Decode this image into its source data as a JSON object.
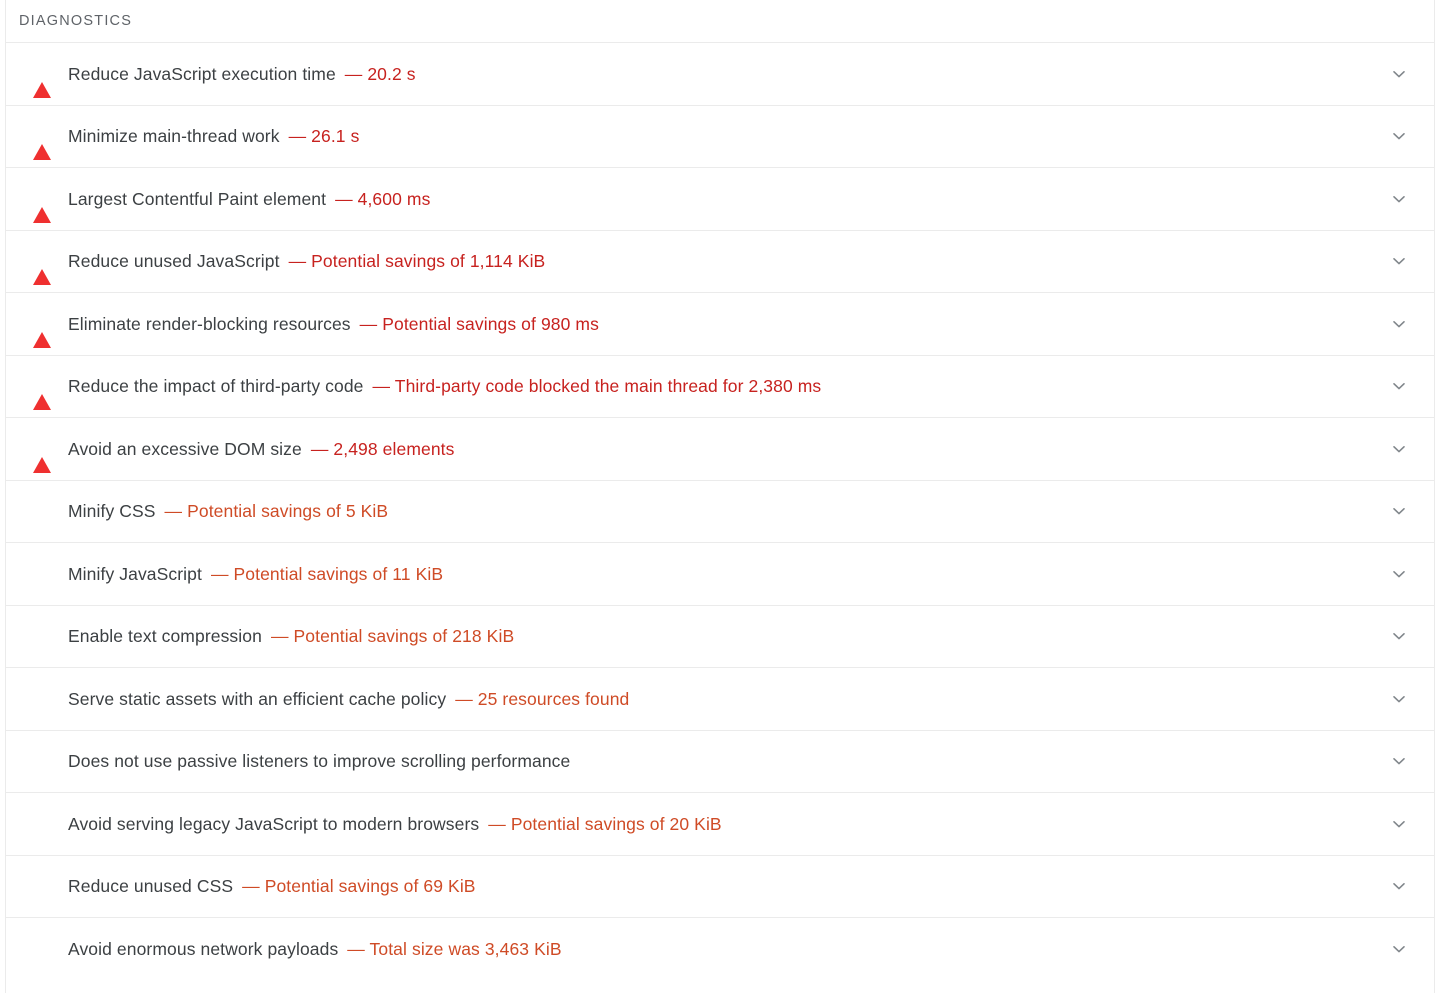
{
  "panel": {
    "section_title": "DIAGNOSTICS",
    "expand_icon": "chevron-down-icon",
    "colors": {
      "fail_icon": "#ef3030",
      "average_icon": "#f7a633",
      "fail_text": "#c7221f",
      "average_text": "#cf4b26",
      "title_text": "#3c4043",
      "header_text": "#5f6368",
      "divider": "#ebebeb"
    },
    "audits": [
      {
        "title": "Reduce JavaScript execution time",
        "value": "— 20.2 s",
        "severity": "fail",
        "icon": "fail-triangle-icon"
      },
      {
        "title": "Minimize main-thread work",
        "value": "— 26.1 s",
        "severity": "fail",
        "icon": "fail-triangle-icon"
      },
      {
        "title": "Largest Contentful Paint element",
        "value": "— 4,600 ms",
        "severity": "fail",
        "icon": "fail-triangle-icon"
      },
      {
        "title": "Reduce unused JavaScript",
        "value": "— Potential savings of 1,114 KiB",
        "severity": "fail",
        "icon": "fail-triangle-icon"
      },
      {
        "title": "Eliminate render-blocking resources",
        "value": "— Potential savings of 980 ms",
        "severity": "fail",
        "icon": "fail-triangle-icon"
      },
      {
        "title": "Reduce the impact of third-party code",
        "value": "— Third-party code blocked the main thread for 2,380 ms",
        "severity": "fail",
        "icon": "fail-triangle-icon"
      },
      {
        "title": "Avoid an excessive DOM size",
        "value": "— 2,498 elements",
        "severity": "fail",
        "icon": "fail-triangle-icon"
      },
      {
        "title": "Minify CSS",
        "value": "— Potential savings of 5 KiB",
        "severity": "average",
        "icon": "average-square-icon"
      },
      {
        "title": "Minify JavaScript",
        "value": "— Potential savings of 11 KiB",
        "severity": "average",
        "icon": "average-square-icon"
      },
      {
        "title": "Enable text compression",
        "value": "— Potential savings of 218 KiB",
        "severity": "average",
        "icon": "average-square-icon"
      },
      {
        "title": "Serve static assets with an efficient cache policy",
        "value": "— 25 resources found",
        "severity": "average",
        "icon": "average-square-icon"
      },
      {
        "title": "Does not use passive listeners to improve scrolling performance",
        "value": "",
        "severity": "average",
        "icon": "average-square-icon"
      },
      {
        "title": "Avoid serving legacy JavaScript to modern browsers",
        "value": "— Potential savings of 20 KiB",
        "severity": "average",
        "icon": "average-square-icon"
      },
      {
        "title": "Reduce unused CSS",
        "value": "— Potential savings of 69 KiB",
        "severity": "average",
        "icon": "average-square-icon"
      },
      {
        "title": "Avoid enormous network payloads",
        "value": "— Total size was 3,463 KiB",
        "severity": "average",
        "icon": "average-square-icon"
      }
    ]
  }
}
